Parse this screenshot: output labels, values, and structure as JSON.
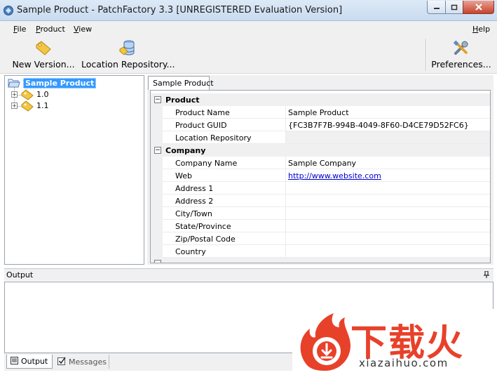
{
  "window": {
    "title": "Sample Product  -  PatchFactory 3.3  [UNREGISTERED Evaluation Version]"
  },
  "menu": {
    "file": {
      "letter": "F",
      "rest": "ile"
    },
    "product": {
      "letter": "P",
      "rest": "roduct"
    },
    "view": {
      "letter": "V",
      "rest": "iew"
    },
    "help": {
      "letter": "H",
      "rest": "elp"
    }
  },
  "toolbar": {
    "new_version": "New Version...",
    "location_repository": "Location Repository...",
    "preferences": "Preferences..."
  },
  "tree": {
    "root": "Sample Product",
    "children": [
      "1.0",
      "1.1"
    ]
  },
  "tabs": {
    "main": "Sample Product"
  },
  "properties": {
    "product": {
      "label": "Product",
      "rows": [
        {
          "key": "Product Name",
          "value": "Sample Product"
        },
        {
          "key": "Product GUID",
          "value": "{FC3B7F7B-994B-4049-8F60-D4CE79D52FC6}"
        },
        {
          "key": "Location Repository",
          "value": ""
        }
      ]
    },
    "company": {
      "label": "Company",
      "rows": [
        {
          "key": "Company Name",
          "value": "Sample Company"
        },
        {
          "key": "Web",
          "value": "http://www.website.com"
        },
        {
          "key": "Address 1",
          "value": ""
        },
        {
          "key": "Address 2",
          "value": ""
        },
        {
          "key": "City/Town",
          "value": ""
        },
        {
          "key": "State/Province",
          "value": ""
        },
        {
          "key": "Zip/Postal Code",
          "value": ""
        },
        {
          "key": "Country",
          "value": ""
        }
      ]
    }
  },
  "output": {
    "title": "Output",
    "tabs": {
      "output": "Output",
      "messages": "Messages"
    }
  },
  "watermark": {
    "cn": "下载火",
    "en": "xiazaihuo.com"
  },
  "colors": {
    "selection": "#3399ff",
    "link": "#0000d0",
    "watermark": "#e8412a"
  }
}
